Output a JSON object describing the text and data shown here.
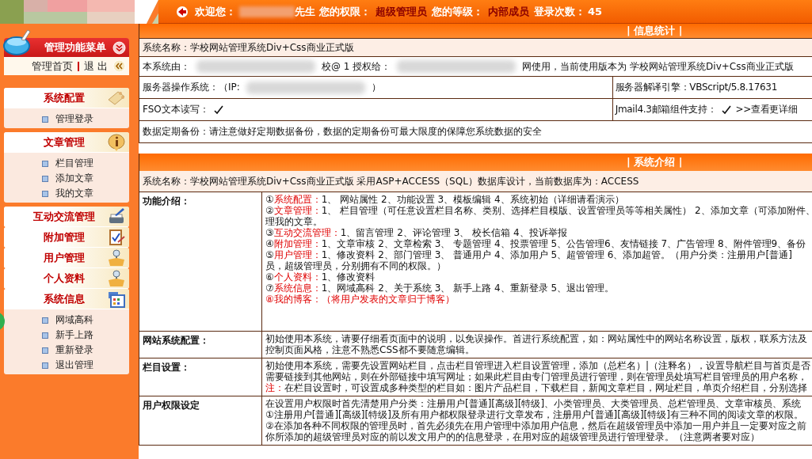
{
  "top_bar": {
    "welcome_label": "欢迎您：",
    "name_suffix": "先生",
    "permission_label": "您的权限：",
    "permission": "超级管理员",
    "level_label": "您的等级：",
    "level": "内部成员",
    "login_label": "登录次数：",
    "login_count": "45"
  },
  "sidebar": {
    "title": "管理功能菜单",
    "links": [
      "管理首页",
      "退 出"
    ],
    "sections": [
      {
        "title": "系统配置",
        "expanded": true,
        "items": [
          "管理登录"
        ]
      },
      {
        "title": "文章管理",
        "expanded": true,
        "items": [
          "栏目管理",
          "添加文章",
          "我的文章"
        ]
      },
      {
        "title": "互动交流管理",
        "expanded": false
      },
      {
        "title": "附加管理",
        "expanded": false
      },
      {
        "title": "用户管理",
        "expanded": false
      },
      {
        "title": "个人资料",
        "expanded": false
      },
      {
        "title": "系统信息",
        "expanded": true,
        "items": [
          "网域高科",
          "新手上路",
          "重新登录",
          "退出管理"
        ]
      }
    ]
  },
  "info_stats": {
    "title": "| 信息统计 |",
    "rows": [
      {
        "shaded": true,
        "cells": [
          {
            "parts": [
              {
                "kind": "text",
                "text": "系统名称：学校网站管理系统Div+Css商业正式版"
              }
            ]
          }
        ]
      },
      {
        "shaded": false,
        "cells": [
          {
            "parts": [
              {
                "kind": "text",
                "text": "本系统由："
              },
              {
                "kind": "blurred"
              },
              {
                "kind": "text",
                "text": "校@ 1 授权给："
              },
              {
                "kind": "blurred"
              },
              {
                "kind": "text",
                "text": "网使用，当前使用版本为 学校网站管理系统Div+Css商业正式版"
              }
            ]
          }
        ]
      },
      {
        "shaded": false,
        "cells": [
          {
            "parts": [
              {
                "kind": "text",
                "text": "服务器操作系统：（IP:"
              },
              {
                "kind": "blurred"
              },
              {
                "kind": "text",
                "text": "）"
              }
            ]
          },
          {
            "parts": [
              {
                "kind": "text",
                "text": "服务器解译引擎：VBScript/5.8.17631"
              }
            ]
          }
        ]
      },
      {
        "shaded": false,
        "cells": [
          {
            "parts": [
              {
                "kind": "text",
                "text": "FSO文本读写："
              },
              {
                "kind": "check",
                "supported": true
              }
            ]
          },
          {
            "parts": [
              {
                "kind": "text",
                "text": "Jmail4.3邮箱组件支持："
              },
              {
                "kind": "check",
                "supported": true
              },
              {
                "kind": "link",
                "text": ">>查看更详细"
              }
            ]
          }
        ]
      },
      {
        "shaded": false,
        "cells": [
          {
            "parts": [
              {
                "kind": "text",
                "text": "数据定期备份：请注意做好定期数据备份，数据的定期备份可最大限度的保障您系统数据的安全"
              }
            ]
          }
        ]
      }
    ]
  },
  "system_intro": {
    "title": "| 系统介绍 |",
    "summary": "系统名称：学校网站管理系统Div+Css商业正式版 采用ASP+ACCESS（SQL）数据库设计，当前数据库为：ACCESS",
    "sections": [
      {
        "heading": "功能介绍：",
        "lines": [
          {
            "num": "①",
            "label": "系统配置：",
            "text": "1、 网站属性 2、功能设置 3、模板编辑 4、系统初始（详细请看演示）",
            "emphasis": false
          },
          {
            "num": "②",
            "label": "文章管理：",
            "text": "1、 栏目管理（可任意设置栏目名称、类别、选择栏目模版、设置管理员等等相关属性） 2、添加文章（可添加附件、",
            "emphasis": false
          },
          {
            "text": "理我的文章。",
            "emphasis": false
          },
          {
            "num": "③",
            "label": "互动交流管理：",
            "text": "1、留言管理 2、评论管理 3、 校长信箱 4、投诉举报",
            "emphasis": false
          },
          {
            "num": "④",
            "label": "附加管理：",
            "text": "1、文章审核 2、文章检索 3、 专题管理 4、投票管理 5、公告管理6、友情链接 7、广告管理 8、附件管理9、备份",
            "emphasis": false
          },
          {
            "num": "⑤",
            "label": "用户管理：",
            "text": "1、修改资料 2、部门管理 3、 普通用户 4、添加用户 5、超管管理 6、添加超管。（用户分类：注册用户[普通]",
            "emphasis": false
          },
          {
            "text": "员，超级管理员，分别拥有不同的权限。）",
            "emphasis": false
          },
          {
            "num": "⑥",
            "label": "个人资料：",
            "text": "1、修改资料",
            "emphasis": false
          },
          {
            "num": "⑦",
            "label": "系统信息：",
            "text": "1、网域高科 2、关于系统 3、 新手上路 4、重新登录 5、退出管理。",
            "emphasis": false
          },
          {
            "num": "⑧",
            "label": "我的博客：",
            "text": "（将用户发表的文章归于博客）",
            "emphasis": true
          }
        ]
      },
      {
        "heading": "网站系统配置：",
        "lines": [
          {
            "text": "初始使用本系统，请要仔细看页面中的说明，以免误操作。首进行系统配置，如：网站属性中的网站名称设置，版权，联系方法及",
            "emphasis": false
          },
          {
            "text": "控制页面风格，注意不熟悉CSS都不要随意编辑。",
            "emphasis": false
          }
        ]
      },
      {
        "heading": "栏目设置：",
        "lines": [
          {
            "text": "初始使用本系统，需要先设置网站栏目，点击栏目管理进入栏目设置管理，添加（总栏名）|（注释名），设置导航栏目与首页是否",
            "emphasis": false
          },
          {
            "text": "需要链接到其他网站，则在外部链接中填写网址；如果此栏目由专门管理员进行管理，则在管理员处填写栏目管理员的用户名称，",
            "emphasis": false
          },
          {
            "label": "注：",
            "text": "在栏目设置时，可设置成多种类型的栏目如：图片产品栏目，下载栏目，新闻文章栏目，网址栏目，单页介绍栏目，分别选择",
            "emphasis": false
          }
        ]
      },
      {
        "heading": "用户权限设定",
        "lines": [
          {
            "text": "在设置用户权限时首先清楚用户分类：注册用户[普通][高级][特级]、小类管理员、大类管理员、总栏管理员、文章审核员、系统",
            "emphasis": false
          },
          {
            "text": "①注册用户[普通][高级][特级]及所有用户都权限登录进行文章发布，注册用户[普通][高级][特级]有三种不同的阅读文章的权限。",
            "emphasis": false
          },
          {
            "text": "②在添加各种不同权限的管理员时，首先必须先在用户管理中添加用户信息，然后在超级管理员中添加一用户并且一定要对应之前",
            "emphasis": false
          },
          {
            "text": "你所添加的超级管理员对应的前以发文用户的的信息登录，在用对应的超级管理员进行管理登录。（注意两者要对应）",
            "emphasis": false
          }
        ]
      }
    ]
  }
}
